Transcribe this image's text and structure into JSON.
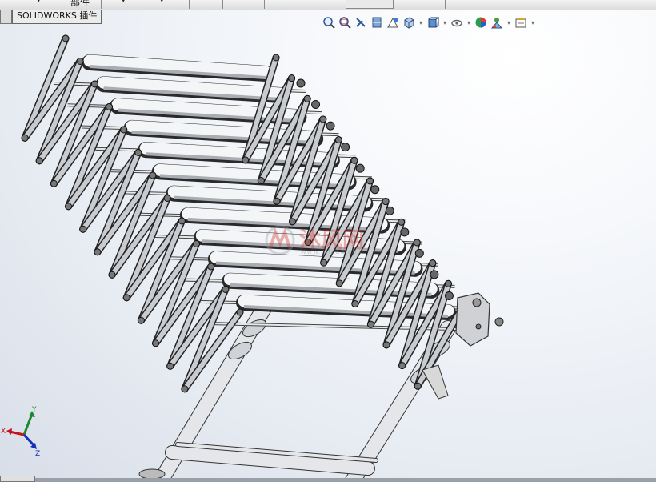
{
  "app": {
    "ribbon_tabs": {
      "parts_label": "部件"
    },
    "command_tab": {
      "label": "SOLIDWORKS 插件"
    }
  },
  "heads_up_toolbar": {
    "icons": [
      "zoom-to-fit-icon",
      "zoom-to-area-icon",
      "previous-view-icon",
      "section-view-icon",
      "dynamic-annotation-icon",
      "view-orientation-icon",
      "display-style-icon",
      "hide-show-items-icon",
      "edit-appearance-icon",
      "apply-scene-icon",
      "view-settings-icon"
    ]
  },
  "viewport": {
    "model": "scissor-lift-conveyor-assembly",
    "background_gradient": [
      "#ffffff",
      "#e6ebf2",
      "#d8dee8"
    ]
  },
  "watermark": {
    "text": "沐风网",
    "subtext": "www.mfcad.com",
    "color": "#d4342c"
  },
  "triad": {
    "x_label": "X",
    "y_label": "Y",
    "z_label": "Z",
    "x_color": "#c0161b",
    "y_color": "#1b8a2b",
    "z_color": "#1730b5"
  }
}
